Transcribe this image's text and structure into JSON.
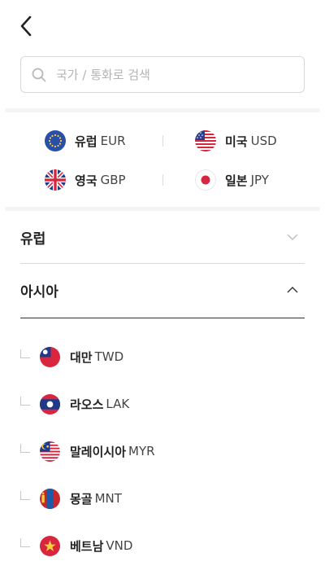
{
  "search": {
    "placeholder": "국가 / 통화로 검색"
  },
  "favorites": [
    {
      "name": "유럽",
      "code": "EUR",
      "flag": "eu-flag-icon"
    },
    {
      "name": "미국",
      "code": "USD",
      "flag": "us-flag-icon"
    },
    {
      "name": "영국",
      "code": "GBP",
      "flag": "uk-flag-icon"
    },
    {
      "name": "일본",
      "code": "JPY",
      "flag": "jp-flag-icon"
    }
  ],
  "regions": [
    {
      "label": "유럽",
      "expanded": false
    },
    {
      "label": "아시아",
      "expanded": true
    }
  ],
  "asia_countries": [
    {
      "name": "대만",
      "code": "TWD",
      "flag": "tw-flag-icon"
    },
    {
      "name": "라오스",
      "code": "LAK",
      "flag": "la-flag-icon"
    },
    {
      "name": "말레이시아",
      "code": "MYR",
      "flag": "my-flag-icon"
    },
    {
      "name": "몽골",
      "code": "MNT",
      "flag": "mn-flag-icon"
    },
    {
      "name": "베트남",
      "code": "VND",
      "flag": "vn-flag-icon"
    }
  ],
  "colors": {
    "border": "#d9d9d9",
    "band": "#f4f4f4",
    "text": "#222222"
  }
}
